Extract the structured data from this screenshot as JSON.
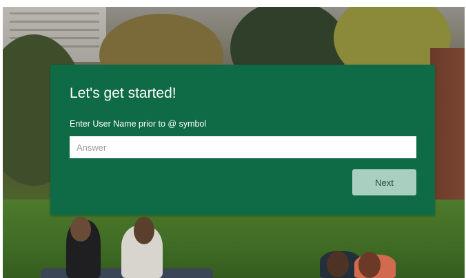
{
  "card": {
    "title": "Let's get started!",
    "field_label": "Enter User Name prior to @ symbol",
    "input": {
      "value": "",
      "placeholder": "Answer"
    },
    "next_label": "Next"
  },
  "colors": {
    "card_background": "#0f6b46",
    "button_background": "#a9cfc0",
    "button_text": "#234a3a"
  }
}
